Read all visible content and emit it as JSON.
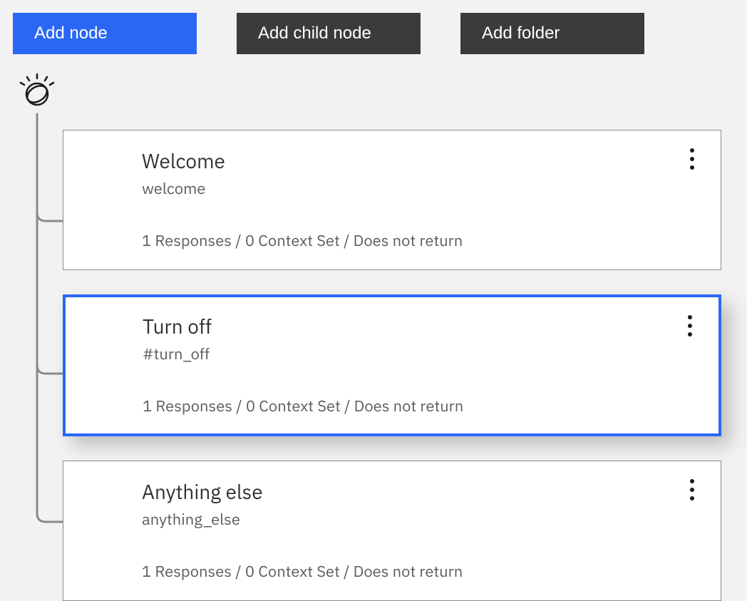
{
  "toolbar": {
    "add_node": "Add node",
    "add_child_node": "Add child node",
    "add_folder": "Add folder"
  },
  "nodes": [
    {
      "title": "Welcome",
      "condition": "welcome",
      "summary": "1 Responses / 0 Context Set / Does not return",
      "selected": false
    },
    {
      "title": "Turn off",
      "condition": "#turn_off",
      "summary": "1 Responses / 0 Context Set / Does not return",
      "selected": true
    },
    {
      "title": "Anything else",
      "condition": "anything_else",
      "summary": "1 Responses / 0 Context Set / Does not return",
      "selected": false
    }
  ]
}
